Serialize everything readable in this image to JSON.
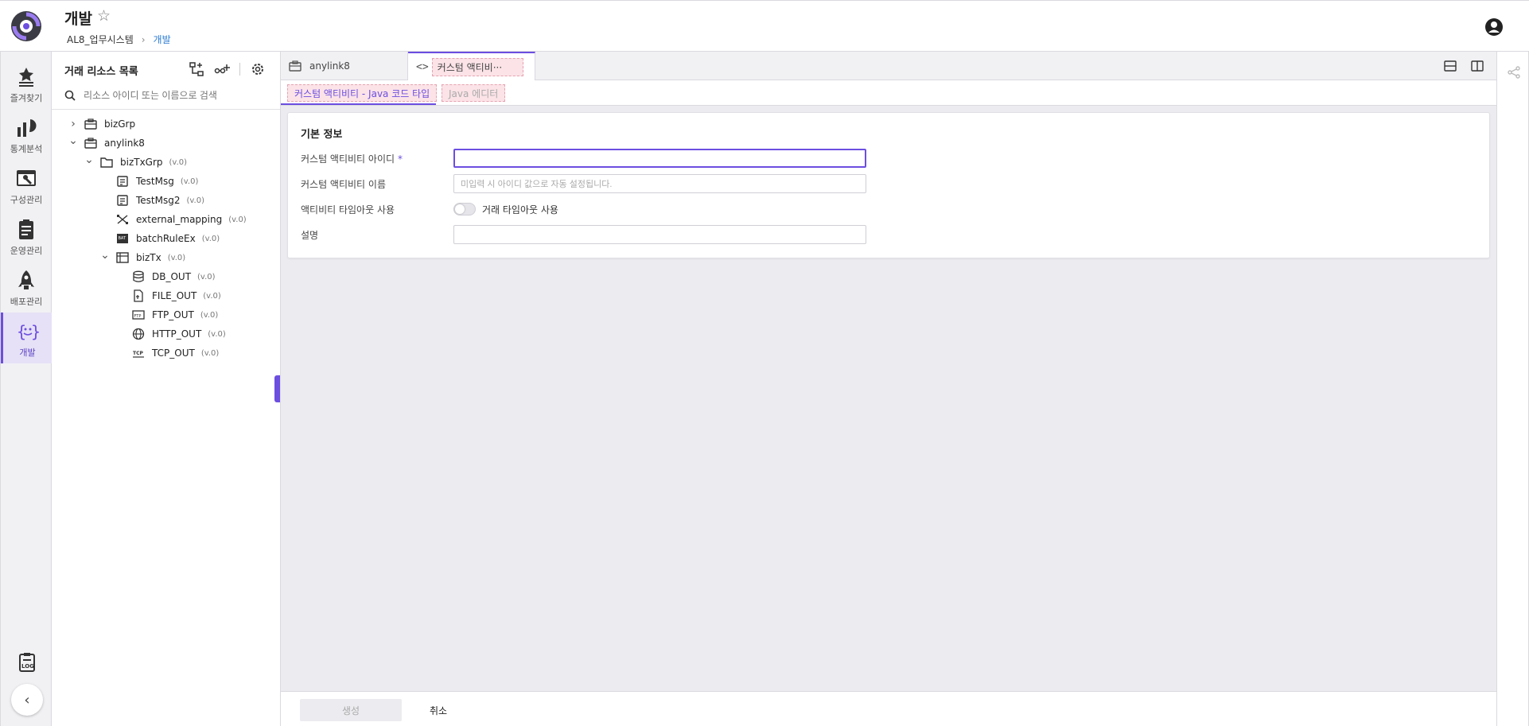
{
  "header": {
    "title": "개발",
    "breadcrumb": [
      "AL8_업무시스템",
      "개발"
    ]
  },
  "leftnav": {
    "items": [
      {
        "label": "즐겨찾기",
        "icon": "favorites-icon"
      },
      {
        "label": "통계분석",
        "icon": "statistics-icon"
      },
      {
        "label": "구성관리",
        "icon": "config-icon"
      },
      {
        "label": "운영관리",
        "icon": "operations-icon"
      },
      {
        "label": "배포관리",
        "icon": "deploy-rocket-icon"
      },
      {
        "label": "개발",
        "icon": "dev-code-icon",
        "active": true
      }
    ]
  },
  "resources": {
    "title": "거래 리소스 목록",
    "search_placeholder": "리소스 아이디 또는 이름으로 검색",
    "tree": [
      {
        "name": "bizGrp",
        "ver": "",
        "level": 0,
        "chev": "right",
        "icon": "briefcase-icon"
      },
      {
        "name": "anylink8",
        "ver": "",
        "level": 0,
        "chev": "down",
        "icon": "briefcase-icon"
      },
      {
        "name": "bizTxGrp",
        "ver": "(v.0)",
        "level": 1,
        "chev": "down",
        "icon": "folder-icon"
      },
      {
        "name": "TestMsg",
        "ver": "(v.0)",
        "level": 2,
        "chev": "",
        "icon": "message-icon"
      },
      {
        "name": "TestMsg2",
        "ver": "(v.0)",
        "level": 2,
        "chev": "",
        "icon": "message-icon"
      },
      {
        "name": "external_mapping",
        "ver": "(v.0)",
        "level": 2,
        "chev": "",
        "icon": "mapping-icon"
      },
      {
        "name": "batchRuleEx",
        "ver": "(v.0)",
        "level": 2,
        "chev": "",
        "icon": "batch-icon"
      },
      {
        "name": "bizTx",
        "ver": "(v.0)",
        "level": 2,
        "chev": "down",
        "icon": "transaction-icon"
      },
      {
        "name": "DB_OUT",
        "ver": "(v.0)",
        "level": 3,
        "chev": "",
        "icon": "database-icon"
      },
      {
        "name": "FILE_OUT",
        "ver": "(v.0)",
        "level": 3,
        "chev": "",
        "icon": "file-icon"
      },
      {
        "name": "FTP_OUT",
        "ver": "(v.0)",
        "level": 3,
        "chev": "",
        "icon": "ftp-icon"
      },
      {
        "name": "HTTP_OUT",
        "ver": "(v.0)",
        "level": 3,
        "chev": "",
        "icon": "globe-icon"
      },
      {
        "name": "TCP_OUT",
        "ver": "(v.0)",
        "level": 3,
        "chev": "",
        "icon": "tcp-icon"
      }
    ]
  },
  "tabs": [
    {
      "label": "anylink8",
      "icon": "briefcase-icon"
    },
    {
      "label": "커스텀 액티비···",
      "icon": "code-brackets-icon"
    }
  ],
  "subtabs": [
    "커스텀 액티비티 - Java 코드 타입",
    "Java 에디터"
  ],
  "form": {
    "section_title": "기본 정보",
    "id_label": "커스텀 액티비티 아이디",
    "required_mark": "*",
    "id_value": "",
    "name_label": "커스텀 액티비티 이름",
    "name_placeholder": "미입력 시 아이디 값으로 자동 설정됩니다.",
    "timeout_label": "액티비티 타임아웃 사용",
    "timeout_toggle_label": "거래 타임아웃 사용",
    "desc_label": "설명",
    "desc_value": ""
  },
  "footer": {
    "create_label": "생성",
    "cancel_label": "취소"
  },
  "colors": {
    "accent": "#6c4ee0",
    "tab_highlight": "#fbe3e8"
  }
}
